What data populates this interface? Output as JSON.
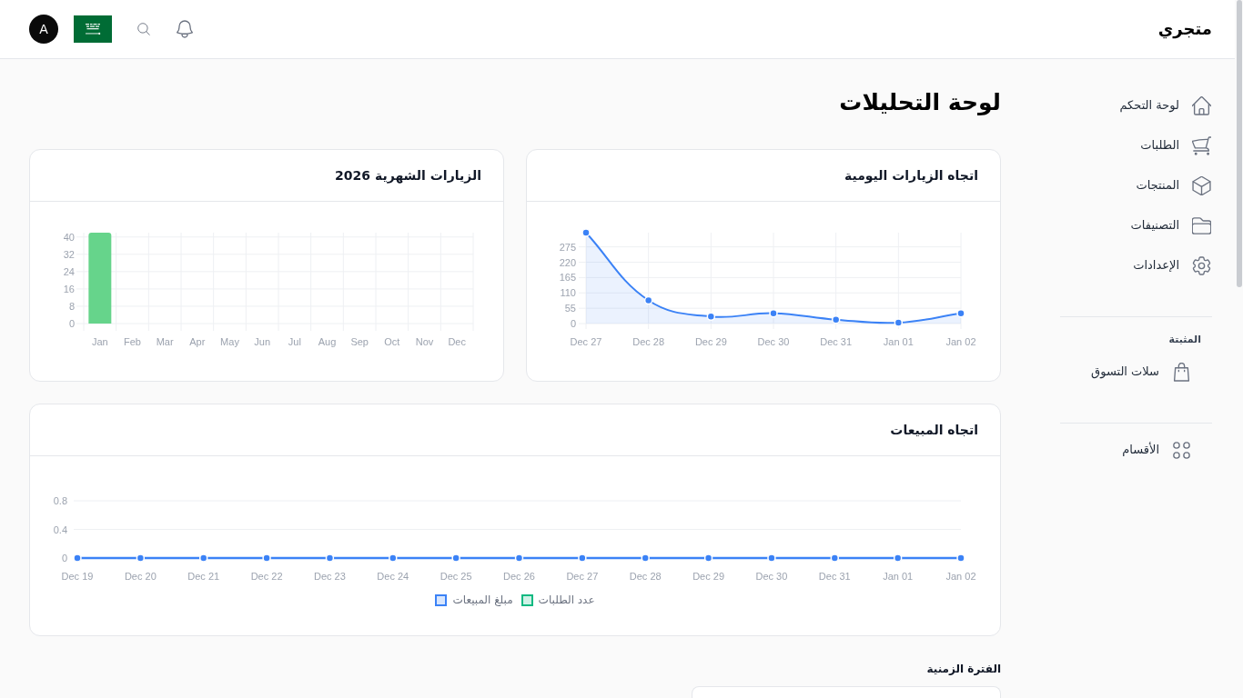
{
  "header": {
    "logo": "متجري",
    "avatar": "A"
  },
  "sidebar": {
    "items": [
      {
        "label": "لوحة التحكم"
      },
      {
        "label": "الطلبات"
      },
      {
        "label": "المنتجات"
      },
      {
        "label": "التصنيفات"
      },
      {
        "label": "الإعدادات"
      }
    ],
    "pinned": {
      "title": "المثبتة",
      "items": [
        {
          "label": "سلات التسوق"
        }
      ]
    },
    "more_items": [
      {
        "label": "الأقسام"
      }
    ]
  },
  "page_title": "لوحة التحليلات",
  "daily_visits": {
    "title": "اتجاه الزيارات اليومية",
    "chart_data": {
      "type": "area",
      "categories": [
        "Dec 27",
        "Dec 28",
        "Dec 29",
        "Dec 30",
        "Dec 31",
        "Jan 01",
        "Jan 02"
      ],
      "series": [
        {
          "color": "#3b82f6",
          "marker": true,
          "values": [
            326,
            83,
            25,
            37,
            14,
            3,
            37
          ]
        }
      ],
      "ylim": [
        0,
        326
      ],
      "yticks": [
        0,
        55,
        110,
        165,
        220,
        275
      ],
      "grid": true
    }
  },
  "monthly_visits": {
    "title": "الزيارات الشهرية 2026",
    "chart_data": {
      "type": "bar",
      "categories": [
        "Jan",
        "Feb",
        "Mar",
        "Apr",
        "May",
        "Jun",
        "Jul",
        "Aug",
        "Sep",
        "Oct",
        "Nov",
        "Dec"
      ],
      "series": [
        {
          "color": "#66d48b",
          "values": [
            42,
            0,
            0,
            0,
            0,
            0,
            0,
            0,
            0,
            0,
            0,
            0
          ]
        }
      ],
      "ylim": [
        0,
        42
      ],
      "yticks": [
        0,
        8,
        16,
        24,
        32,
        40
      ],
      "grid": true
    }
  },
  "sales_trend": {
    "title": "اتجاه المبيعات",
    "chart_data": {
      "type": "line",
      "categories": [
        "Dec 19",
        "Dec 20",
        "Dec 21",
        "Dec 22",
        "Dec 23",
        "Dec 24",
        "Dec 25",
        "Dec 26",
        "Dec 27",
        "Dec 28",
        "Dec 29",
        "Dec 30",
        "Dec 31",
        "Jan 01",
        "Jan 02"
      ],
      "series": [
        {
          "name": "عدد الطلبات",
          "color": "#10b981",
          "marker": true,
          "values": [
            null,
            null,
            null,
            null,
            null,
            null,
            null,
            null,
            null,
            null,
            null,
            null,
            null,
            null,
            null
          ]
        },
        {
          "name": "مبلغ المبيعات",
          "color": "#3b82f6",
          "marker": true,
          "values": [
            0,
            0,
            0,
            0,
            0,
            0,
            0,
            0,
            0,
            0,
            0,
            0,
            0,
            0,
            0
          ]
        }
      ],
      "ylim": [
        0,
        0.8
      ],
      "yticks": [
        0,
        0.4,
        0.8
      ],
      "grid": true
    }
  },
  "period_filter": {
    "label": "الفترة الزمنية"
  }
}
